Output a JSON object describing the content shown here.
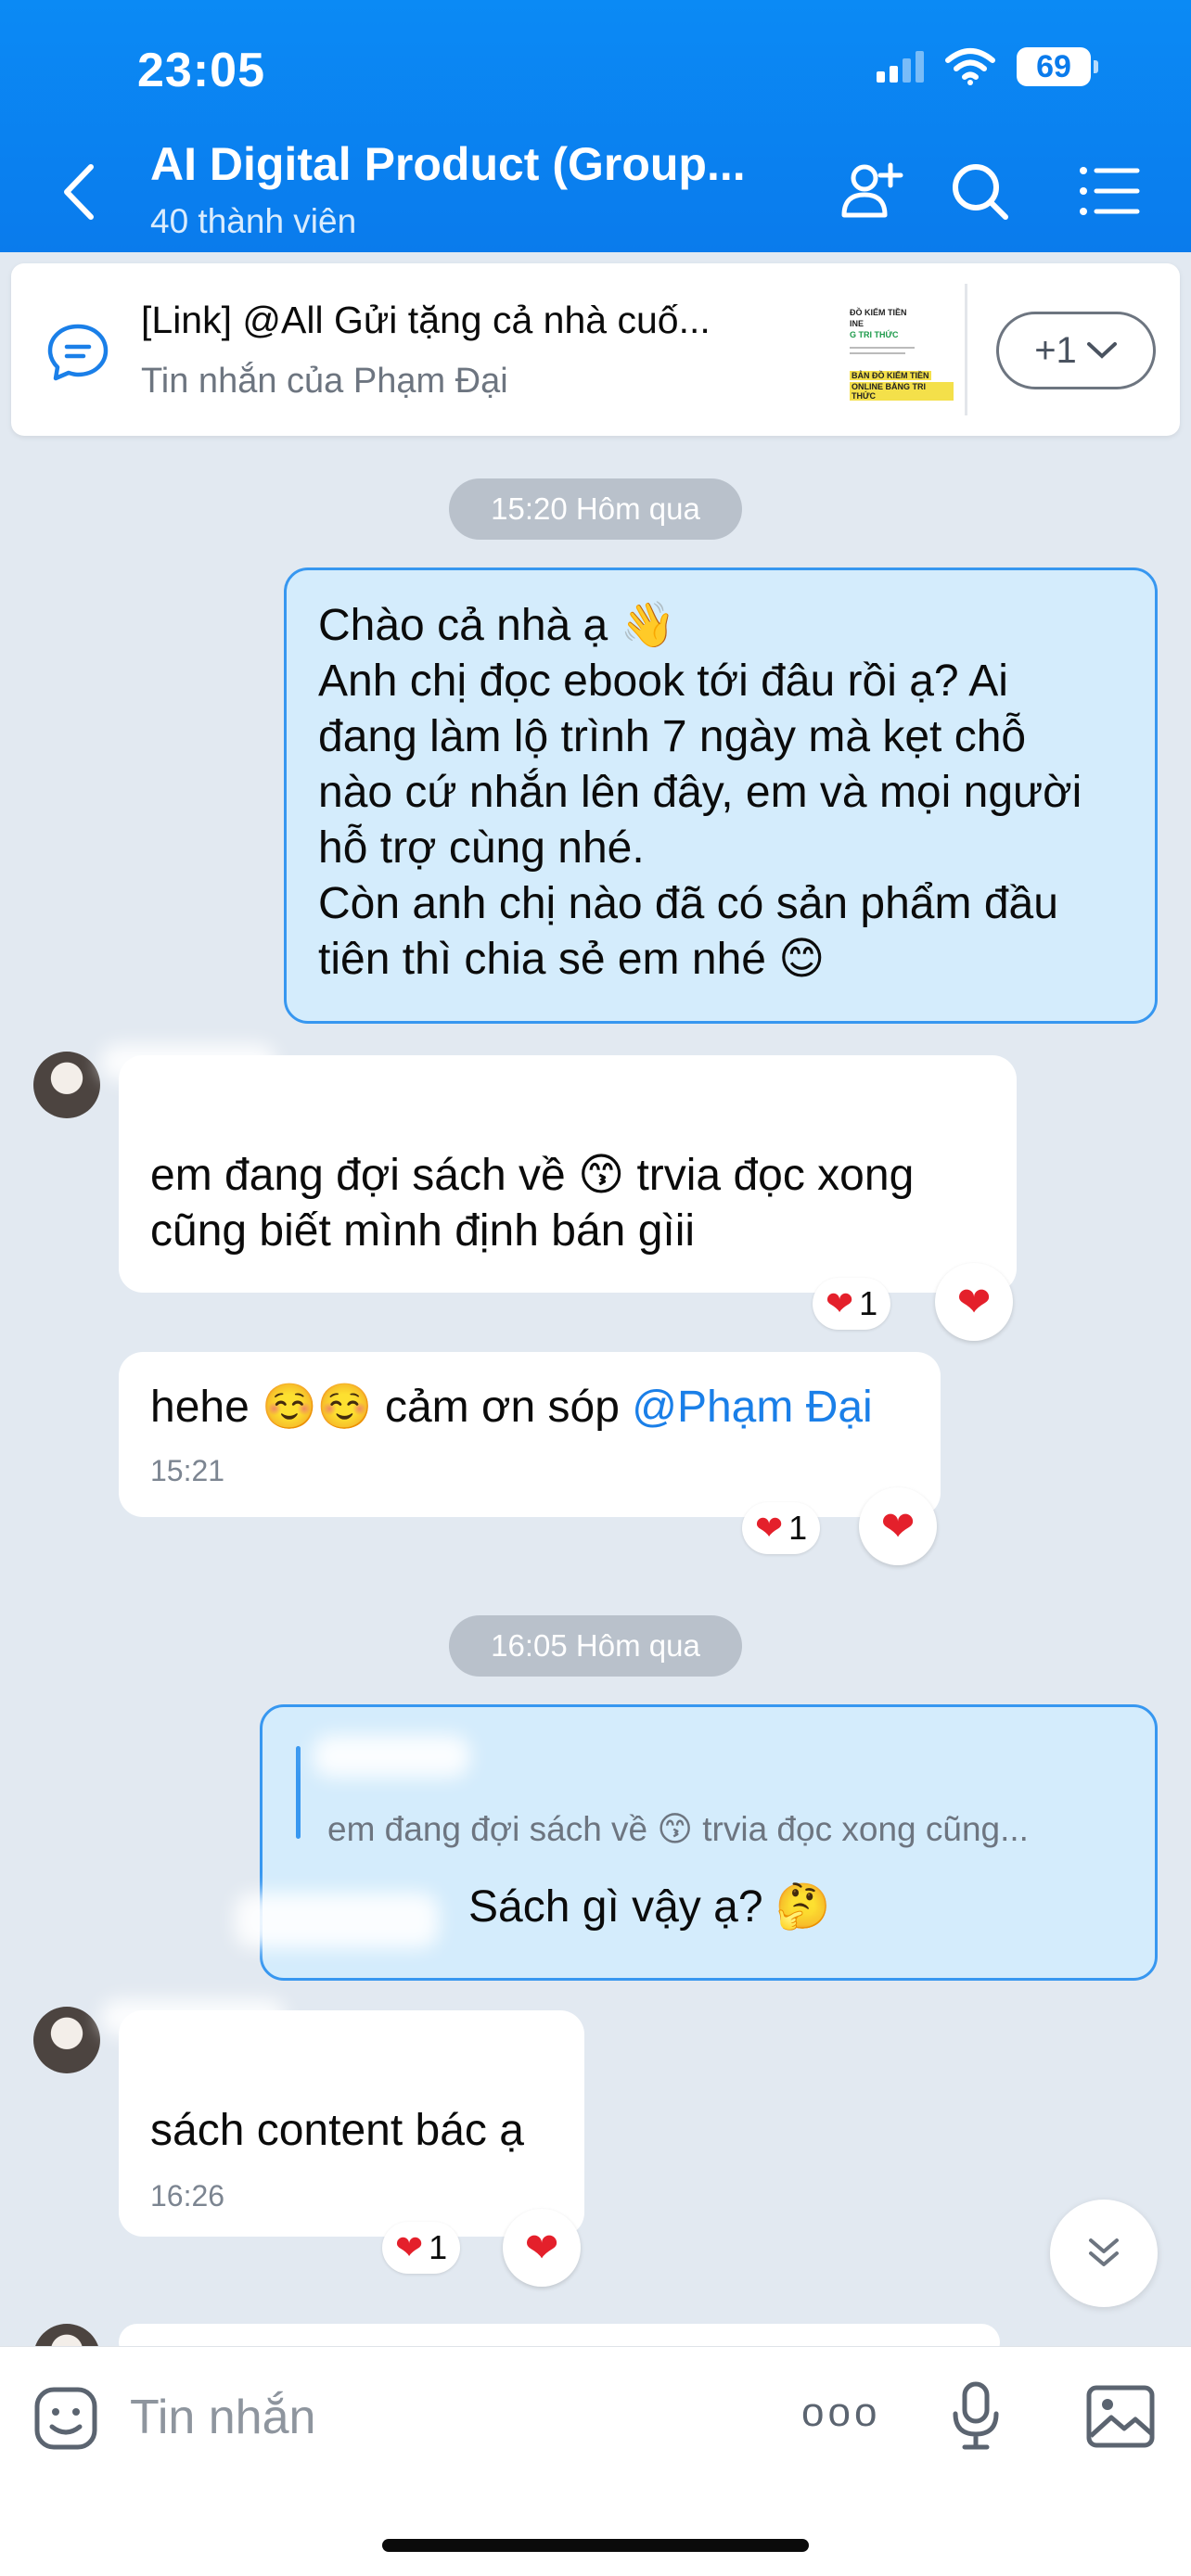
{
  "status_bar": {
    "time": "23:05",
    "battery": "69"
  },
  "header": {
    "title": "AI Digital Product (Group...",
    "subtitle": "40 thành viên"
  },
  "pinned": {
    "title": "[Link] @All Gửi tặng cả nhà cuố...",
    "subtitle": "Tin nhắn của Phạm Đại",
    "thumb_line1": "ĐỒ KIẾM TIỀN",
    "thumb_line2": "INE",
    "thumb_line3": "G TRI THỨC",
    "thumb_line4": "BẢN ĐỒ KIẾM TIỀN",
    "thumb_line5": "ONLINE BẰNG TRI THỨC",
    "more_label": "+1"
  },
  "separators": {
    "first": "15:20 Hôm qua",
    "second": "16:05 Hôm qua"
  },
  "messages": {
    "m1": {
      "line1": "Chào cả nhà ạ 👋",
      "line2": "Anh chị đọc ebook tới đâu rồi ạ? Ai",
      "line3": "đang làm lộ trình 7 ngày mà kẹt chỗ",
      "line4": "nào cứ nhắn lên đây, em và mọi người",
      "line5": "hỗ trợ cùng nhé.",
      "line6": "Còn anh chị nào đã có sản phẩm đầu",
      "line7": "tiên thì chia sẻ em nhé 😊"
    },
    "m2": {
      "line1": "em đang đợi sách về 😙 trvia đọc xong",
      "line2": "cũng biết mình định bán gìii",
      "reaction_count": "1"
    },
    "m3": {
      "text": "hehe ☺️☺️ cảm ơn sóp ",
      "mention": "@Phạm Đại",
      "time": "15:21",
      "reaction_count": "1"
    },
    "m4": {
      "quote": "em đang đợi sách về 😙 trvia đọc xong cũng...",
      "text": "Sách gì vậy ạ? 🤔"
    },
    "m5": {
      "text": "sách content bác ạ",
      "time": "16:26",
      "reaction_count": "1"
    }
  },
  "input": {
    "placeholder": "Tin nhắn",
    "more_label": "ooo"
  },
  "colors": {
    "header": "#0a7bec",
    "my_bubble": "#d4ecfc",
    "accent": "#3797f0",
    "heart": "#e4202b"
  }
}
